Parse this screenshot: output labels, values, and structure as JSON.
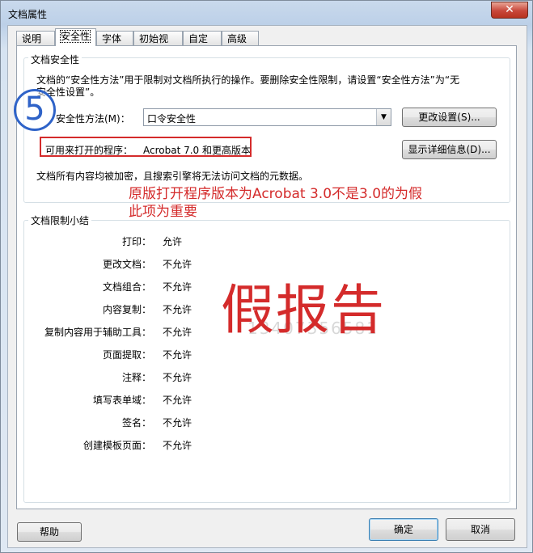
{
  "window": {
    "title": "文档属性",
    "close_glyph": "✕"
  },
  "tabs": [
    {
      "label": "说明"
    },
    {
      "label": "安全性"
    },
    {
      "label": "字体"
    },
    {
      "label": "初始视图"
    },
    {
      "label": "自定义"
    },
    {
      "label": "高级"
    }
  ],
  "active_tab": "安全性",
  "security_group": {
    "label": "文档安全性",
    "description_line1": "文档的“安全性方法”用于限制对文档所执行的操作。要删除安全性限制，请设置“安全性方法”为“无",
    "description_line2": "安全性设置”。",
    "method_label": "安全性方法(M)：",
    "method_value": "口令安全性",
    "change_settings_button": "更改设置(S)...",
    "open_with_label": "可用来打开的程序：",
    "open_with_value": "Acrobat 7.0 和更高版本",
    "show_details_button": "显示详细信息(D)...",
    "encryption_note": "文档所有内容均被加密，且搜索引擎将无法访问文档的元数据。"
  },
  "restrictions_group": {
    "label": "文档限制小结",
    "rows": [
      {
        "label": "打印：",
        "value": "允许"
      },
      {
        "label": "更改文档：",
        "value": "不允许"
      },
      {
        "label": "文档组合：",
        "value": "不允许"
      },
      {
        "label": "内容复制：",
        "value": "不允许"
      },
      {
        "label": "复制内容用于辅助工具：",
        "value": "不允许"
      },
      {
        "label": "页面提取：",
        "value": "不允许"
      },
      {
        "label": "注释：",
        "value": "不允许"
      },
      {
        "label": "填写表单域：",
        "value": "不允许"
      },
      {
        "label": "签名：",
        "value": "不允许"
      },
      {
        "label": "创建模板页面：",
        "value": "不允许"
      }
    ]
  },
  "annotations": {
    "circled_number": "5",
    "note_line1": "原版打开程序版本为Acrobat 3.0不是3.0的为假",
    "note_line2": "此项为重要",
    "watermark": "假报告",
    "watermark_phone": "13407356581"
  },
  "footer": {
    "help_button": "帮助",
    "ok_button": "确定",
    "cancel_button": "取消"
  },
  "colors": {
    "annotation_red": "#d42b2b",
    "annotation_blue": "#2f63c8"
  }
}
